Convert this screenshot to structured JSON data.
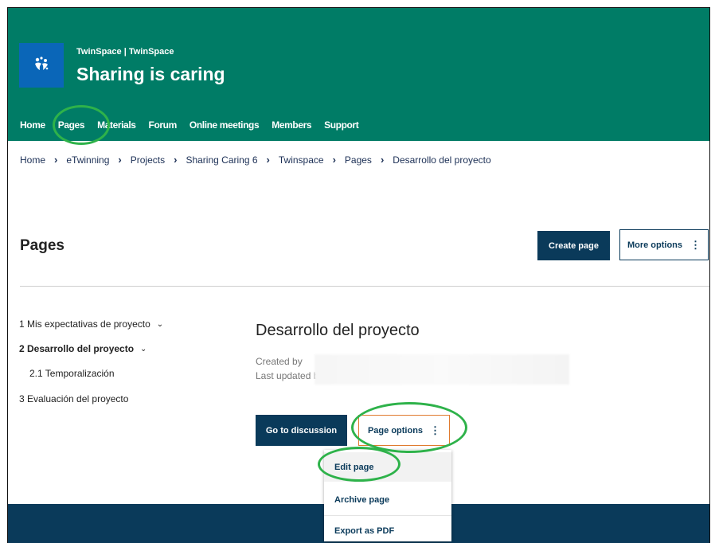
{
  "header": {
    "subtitle": "TwinSpace | TwinSpace",
    "title": "Sharing is caring",
    "logo_icon": "etwinning-logo",
    "background": "#007c66"
  },
  "nav": {
    "items": [
      "Home",
      "Pages",
      "Materials",
      "Forum",
      "Online meetings",
      "Members",
      "Support"
    ]
  },
  "breadcrumb": {
    "items": [
      "Home",
      "eTwinning",
      "Projects",
      "Sharing Caring 6",
      "Twinspace",
      "Pages",
      "Desarrollo del proyecto"
    ],
    "separator": "›"
  },
  "pages": {
    "heading": "Pages",
    "create_label": "Create page",
    "more_label": "More options",
    "more_icon": "kebab-icon"
  },
  "tree": {
    "items": [
      {
        "label": "1  Mis expectativas de proyecto",
        "expandable": true,
        "active": false
      },
      {
        "label": "2  Desarrollo del proyecto",
        "expandable": true,
        "active": true
      },
      {
        "label": "2.1  Temporalización",
        "expandable": false,
        "active": false
      },
      {
        "label": "3  Evaluación del proyecto",
        "expandable": false,
        "active": false
      }
    ]
  },
  "document": {
    "title": "Desarrollo del proyecto",
    "created_label": "Created by",
    "updated_label": "Last updated by",
    "discussion_label": "Go to discussion",
    "page_options_label": "Page options"
  },
  "page_options_menu": {
    "items": [
      "Edit page",
      "Archive page",
      "Export as PDF"
    ]
  },
  "colors": {
    "header": "#007c66",
    "primary": "#0a3a5a",
    "accent_border": "#e07a2e",
    "highlight_ring": "#2eb24a",
    "logo_bg": "#0a66b8"
  }
}
